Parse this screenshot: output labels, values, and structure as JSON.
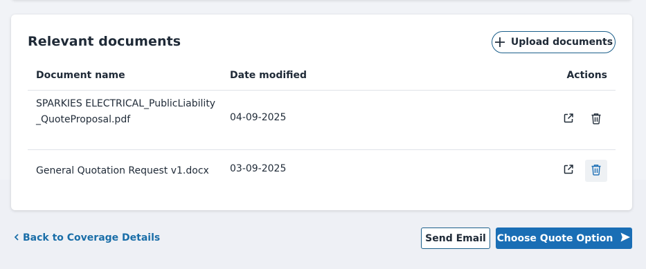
{
  "card": {
    "title": "Relevant documents",
    "upload_label": "Upload documents"
  },
  "table": {
    "headers": {
      "name": "Document name",
      "date": "Date modified",
      "actions": "Actions"
    },
    "rows": [
      {
        "name": "SPARKIES ELECTRICAL_PublicLiability_QuoteProposal.pdf",
        "date": "04-09-2025"
      },
      {
        "name": "General Quotation Request v1.docx",
        "date": "03-09-2025"
      }
    ]
  },
  "footer": {
    "back_label": "Back to Coverage Details",
    "send_email_label": "Send Email",
    "choose_quote_label": "Choose Quote Option"
  },
  "icons": {
    "upload": "plus-icon",
    "open": "external-link-icon",
    "delete": "trash-icon",
    "back": "chevron-left-icon",
    "send": "send-arrow-icon"
  },
  "colors": {
    "accent": "#1a6eb5",
    "link": "#1a6ea8",
    "border": "#1a5e8a"
  }
}
